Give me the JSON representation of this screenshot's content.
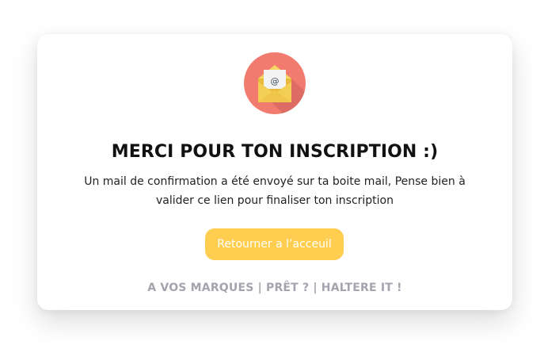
{
  "card": {
    "icon": "envelope-at-icon",
    "title": "MERCI POUR TON INSCRIPTION :)",
    "message": "Un mail de confirmation a été envoyé sur ta boite mail, Pense bien à valider ce lien pour finaliser ton inscription",
    "button_label": "Retourner a l’acceuil",
    "tagline": "A VOS MARQUES | PRÊT ? | HALTERE IT !"
  },
  "colors": {
    "icon_circle": "#f27b70",
    "envelope": "#f4cf56",
    "button_bg": "#ffcd4f",
    "tagline": "#a3a4ad"
  }
}
